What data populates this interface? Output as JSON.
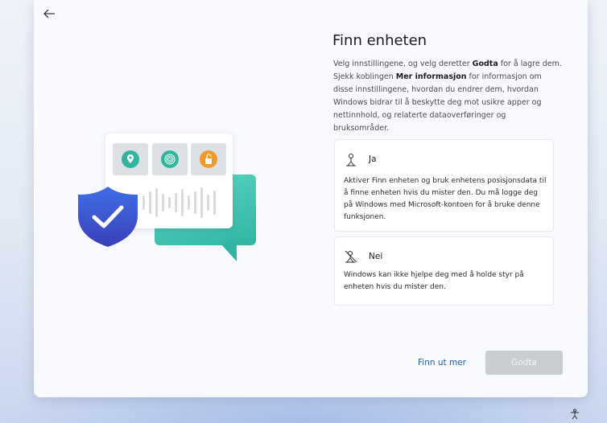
{
  "header": {
    "back_icon": "arrow-left-icon"
  },
  "content": {
    "title": "Finn enheten",
    "description": {
      "part1": "Velg innstillingene, og velg deretter ",
      "bold1": "Godta",
      "part2": " for å lagre dem. Sjekk koblingen ",
      "bold2": "Mer informasjon",
      "part3": " for informasjon om disse innstillingene, hvordan du endrer dem, hvordan Windows bidrar til å beskytte deg mot usikre apper og nettinnhold, og relaterte dataoverføringer og bruksområder."
    },
    "options": [
      {
        "label": "Ja",
        "icon": "location-person-icon",
        "text": "Aktiver Finn enheten og bruk enhetens posisjonsdata til å finne enheten hvis du mister den. Du må logge deg på Windows med Microsoft-kontoen for å bruke denne funksjonen."
      },
      {
        "label": "Nei",
        "icon": "location-off-icon",
        "text": "Windows kan ikke hjelpe deg med å holde styr på enheten hvis du mister den."
      }
    ]
  },
  "footer": {
    "link_label": "Finn ut mer",
    "primary_label": "Godta",
    "primary_disabled": true
  },
  "illustration": {
    "icons": [
      "location-pin-icon",
      "fingerprint-icon",
      "unlock-icon",
      "shield-check-icon"
    ]
  },
  "colors": {
    "accent_teal": "#31b59e",
    "accent_orange": "#f09a2a",
    "shield_blue": "#3d5fe0",
    "link": "#1a5fb4"
  }
}
